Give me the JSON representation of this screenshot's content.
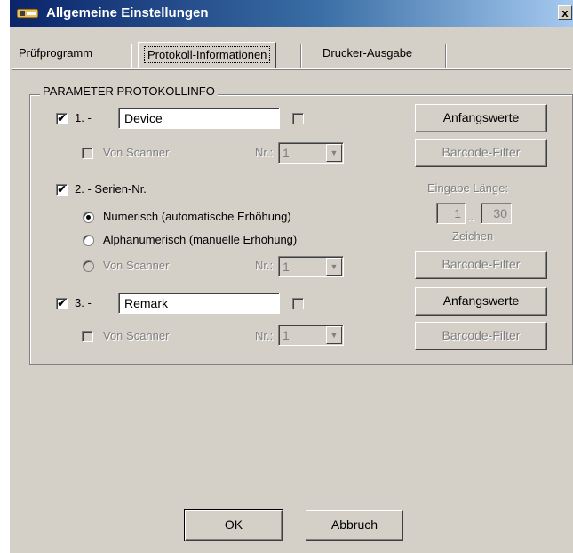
{
  "window": {
    "title": "Allgemeine Einstellungen",
    "close_label": "x",
    "app_icon": "app-icon",
    "colors": {
      "titlebar": "#0a246a",
      "face": "#d4d0c8"
    }
  },
  "tabs": [
    {
      "label": "Prüfprogramm"
    },
    {
      "label": "Protokoll-Informationen",
      "active": true
    },
    {
      "label": "Drucker-Ausgabe"
    }
  ],
  "group": {
    "title": "PARAMETER PROTOKOLLINFO",
    "param1": {
      "label": "1. -",
      "checked": true,
      "value": "Device",
      "from_scanner_label": "Von Scanner",
      "nr_label": "Nr.:",
      "nr_value": "1",
      "initial_values_button": "Anfangswerte",
      "barcode_filter_button": "Barcode-Filter"
    },
    "param2": {
      "label": "2. - Serien-Nr.",
      "checked": true,
      "options": [
        {
          "label": "Numerisch (automatische Erhöhung)",
          "selected": true
        },
        {
          "label": "Alphanumerisch (manuelle Erhöhung)",
          "selected": false
        },
        {
          "label": "Von Scanner",
          "selected": false,
          "disabled": true
        }
      ],
      "nr_label": "Nr.:",
      "nr_value": "1",
      "input_length_label": "Eingabe Länge:",
      "length_min": "1",
      "length_sep": "..",
      "length_max": "30",
      "characters_label": "Zeichen",
      "barcode_filter_button": "Barcode-Filter"
    },
    "param3": {
      "label": "3. -",
      "checked": true,
      "value": "Remark",
      "from_scanner_label": "Von Scanner",
      "nr_label": "Nr.:",
      "nr_value": "1",
      "initial_values_button": "Anfangswerte",
      "barcode_filter_button": "Barcode-Filter"
    }
  },
  "buttons": {
    "ok": "OK",
    "cancel": "Abbruch"
  },
  "checkmark": "✔"
}
